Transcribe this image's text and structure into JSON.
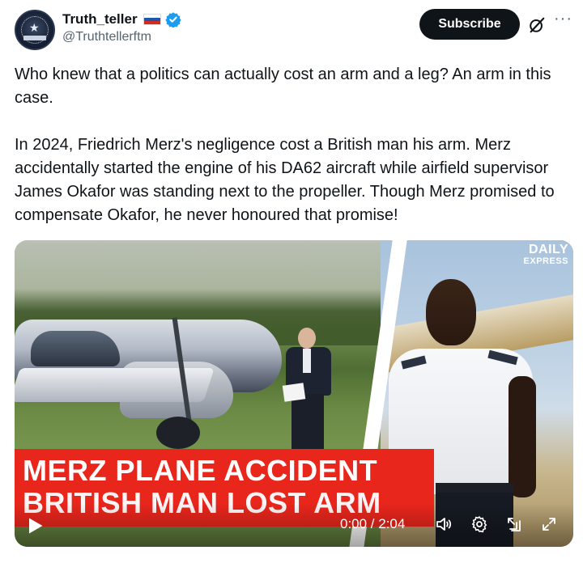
{
  "author": {
    "display_name": "Truth_teller",
    "handle": "@Truthtellerftm",
    "flag_colors": [
      "#ffffff",
      "#1c57a7",
      "#d52b1e"
    ],
    "verified_color": "#1d9bf0"
  },
  "actions": {
    "subscribe_label": "Subscribe"
  },
  "post": {
    "paragraphs": [
      "Who knew that a politics can actually cost an arm and a leg? An arm in this case.",
      "In 2024, Friedrich Merz's negligence cost a British man his arm. Merz accidentally started the engine of his DA62 aircraft while airfield supervisor James Okafor was standing next to the propeller. Though Merz promised to compensate Okafor, he never honoured that promise!"
    ]
  },
  "video": {
    "brand_line1": "DAILY",
    "brand_line2": "EXPRESS",
    "headline_line1": "MERZ PLANE ACCIDENT",
    "headline_line2": "BRITISH MAN LOST ARM",
    "time_display": "0:00 / 2:04",
    "headline_color": "#e8261c"
  },
  "icons": [
    "grok-icon",
    "more-icon",
    "play-icon",
    "volume-icon",
    "settings-icon",
    "pip-icon",
    "fullscreen-icon"
  ]
}
